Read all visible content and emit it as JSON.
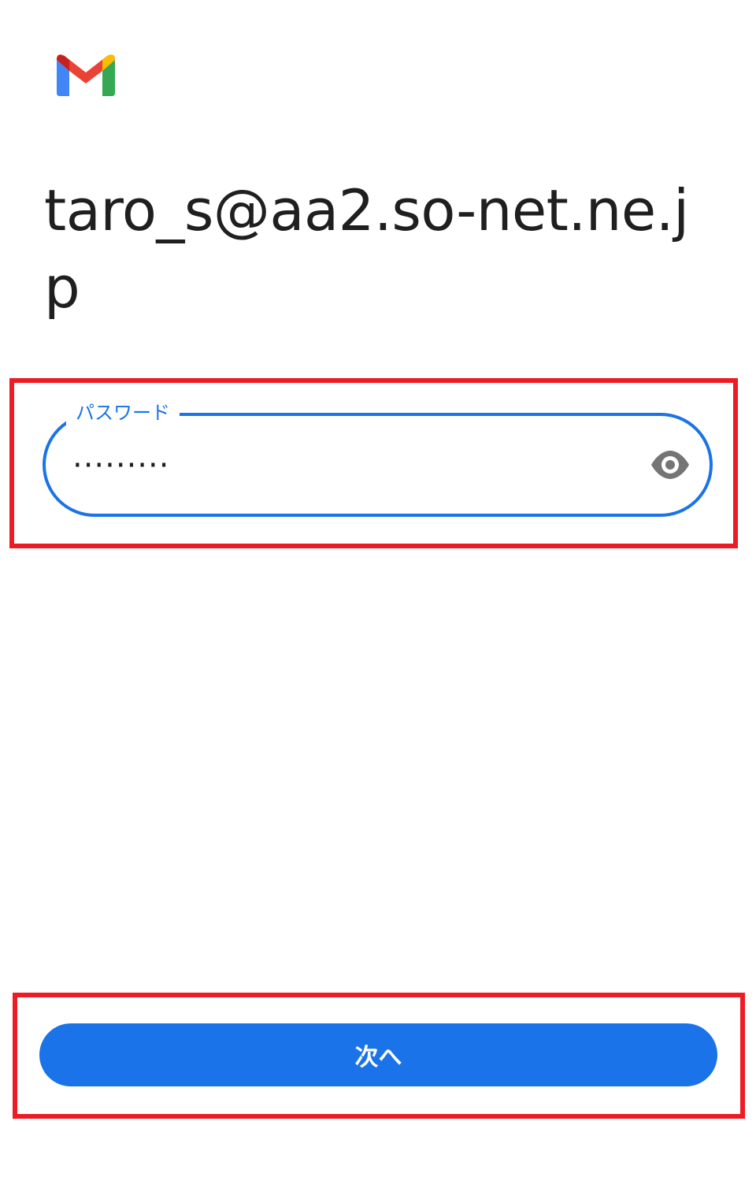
{
  "app": {
    "logo_icon": "gmail-logo-icon",
    "colors": {
      "red": "#ea4335",
      "blue": "#4285f4",
      "green": "#34a853",
      "yellow": "#fbbc04",
      "accent": "#1a73e8",
      "highlight": "#ed1c24"
    }
  },
  "account": {
    "email": "taro_s@aa2.so-net.ne.jp"
  },
  "password": {
    "label": "パスワード",
    "value": "·········",
    "toggle_icon": "eye-icon"
  },
  "actions": {
    "next_label": "次へ"
  }
}
